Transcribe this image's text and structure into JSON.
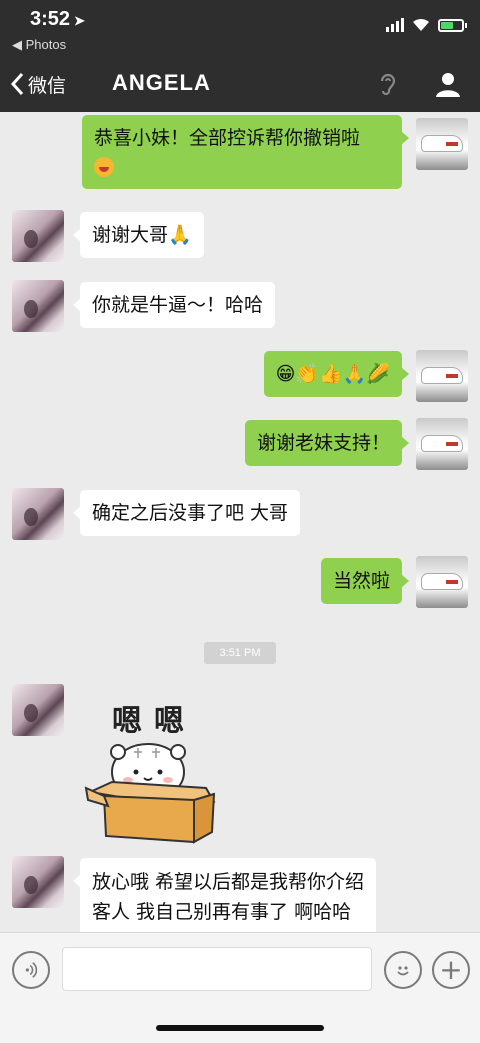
{
  "status_bar": {
    "time": "3:52",
    "location_arrow": "location-arrow-icon",
    "back_app": "◀ Photos"
  },
  "nav": {
    "back_label": "微信",
    "title": "ANGELA"
  },
  "messages": [
    {
      "side": "out",
      "text": "恭喜小妹！全部控诉帮你撤销啦",
      "second_line_emoji": "smile-emoji"
    },
    {
      "side": "in",
      "text": "谢谢大哥🙏"
    },
    {
      "side": "in",
      "text": "你就是牛逼～！哈哈"
    },
    {
      "side": "out",
      "text": "😁👏👍🙏🌽"
    },
    {
      "side": "out",
      "text": "谢谢老妹支持！"
    },
    {
      "side": "in",
      "text": "确定之后没事了吧 大哥"
    },
    {
      "side": "out",
      "text": "当然啦"
    },
    {
      "side": "in",
      "type": "sticker",
      "text": "嗯嗯"
    },
    {
      "side": "in",
      "text": "放心哦 希望以后都是我帮你介绍",
      "text_line2": "客人 我自己别再有事了 啊哈哈"
    }
  ],
  "timestamp": "3:51 PM",
  "input_bar": {
    "placeholder": "",
    "plus_label": "+"
  },
  "colors": {
    "nav_bg": "#2e2e2e",
    "chat_bg": "#ebebeb",
    "outgoing_bubble": "#8fd14f",
    "incoming_bubble": "#ffffff"
  }
}
